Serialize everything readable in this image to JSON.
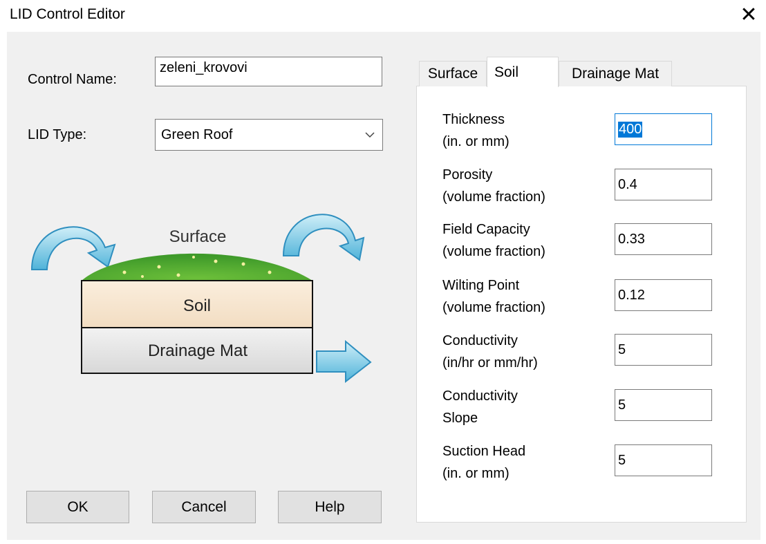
{
  "window": {
    "title": "LID Control Editor",
    "close_symbol": "✕"
  },
  "form": {
    "control_name_label": "Control Name:",
    "control_name_value": "zeleni_krovovi",
    "lid_type_label": "LID Type:",
    "lid_type_value": "Green Roof"
  },
  "diagram": {
    "surface_label": "Surface",
    "soil_label": "Soil",
    "drainage_mat_label": "Drainage Mat"
  },
  "buttons": {
    "ok": "OK",
    "cancel": "Cancel",
    "help": "Help"
  },
  "tabs": [
    {
      "label": "Surface",
      "active": false
    },
    {
      "label": "Soil",
      "active": true
    },
    {
      "label": "Drainage Mat",
      "active": false
    }
  ],
  "soil_params": [
    {
      "line1": "Thickness",
      "line2": "(in. or mm)",
      "value": "400"
    },
    {
      "line1": "Porosity",
      "line2": "(volume fraction)",
      "value": "0.4"
    },
    {
      "line1": "Field Capacity",
      "line2": "(volume fraction)",
      "value": "0.33"
    },
    {
      "line1": "Wilting Point",
      "line2": "(volume fraction)",
      "value": "0.12"
    },
    {
      "line1": "Conductivity",
      "line2": "(in/hr or mm/hr)",
      "value": "5"
    },
    {
      "line1": "Conductivity",
      "line2": "Slope",
      "value": "5"
    },
    {
      "line1": "Suction Head",
      "line2": "(in. or mm)",
      "value": "5"
    }
  ]
}
